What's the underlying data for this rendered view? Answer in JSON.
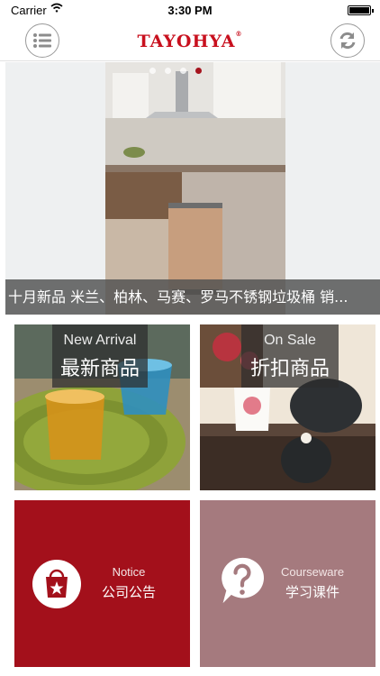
{
  "status_bar": {
    "carrier": "Carrier",
    "time": "3:30 PM",
    "battery_level": 1.0
  },
  "nav": {
    "brand": "TAYOHYA",
    "brand_mark": "®",
    "menu_icon": "list-menu-icon",
    "refresh_icon": "refresh-icon"
  },
  "banner": {
    "caption": "十月新品 米兰、柏林、马赛、罗马不锈钢垃圾桶 销...",
    "pages": 4,
    "active_page": 3
  },
  "tiles": {
    "new_arrival": {
      "en": "New Arrival",
      "zh": "最新商品"
    },
    "on_sale": {
      "en": "On Sale",
      "zh": "折扣商品"
    },
    "notice": {
      "en": "Notice",
      "zh": "公司公告",
      "icon": "shopping-bag-star-icon"
    },
    "courseware": {
      "en": "Courseware",
      "zh": "学习课件",
      "icon": "question-bubble-icon"
    }
  },
  "colors": {
    "brand_red": "#c8101e",
    "notice_bg": "#a3101b",
    "courseware_bg": "#a57a7e",
    "active_dot": "#a5141e"
  }
}
